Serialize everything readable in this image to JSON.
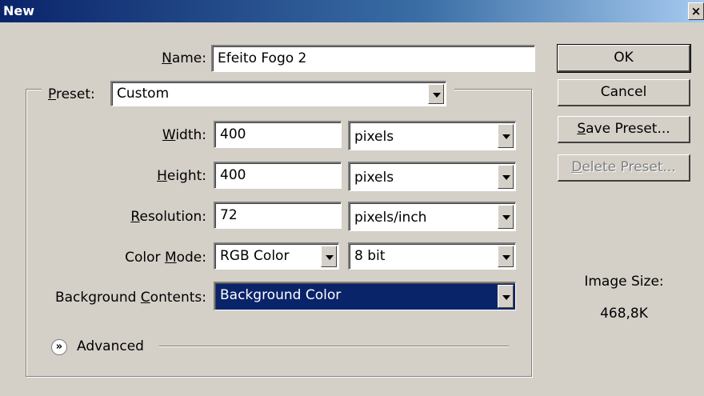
{
  "window": {
    "title": "New",
    "close_label": "×"
  },
  "form": {
    "name": {
      "label_underlined": "N",
      "label_rest": "ame:",
      "value": "Efeito Fogo 2"
    },
    "preset": {
      "label_underlined": "P",
      "label_rest": "reset:",
      "value": "Custom"
    },
    "width": {
      "label_underlined": "W",
      "label_rest": "idth:",
      "value": "400",
      "unit": "pixels"
    },
    "height": {
      "label_underlined": "H",
      "label_rest": "eight:",
      "value": "400",
      "unit": "pixels"
    },
    "resolution": {
      "label_underlined": "R",
      "label_rest": "esolution:",
      "value": "72",
      "unit": "pixels/inch"
    },
    "color_mode": {
      "label_pre": "Color ",
      "label_underlined": "M",
      "label_rest": "ode:",
      "value": "RGB Color",
      "depth": "8 bit"
    },
    "background": {
      "label_pre": "Background ",
      "label_underlined": "C",
      "label_rest": "ontents:",
      "value": "Background Color"
    },
    "advanced": {
      "label": "Advanced",
      "icon": "chevron-double-down-icon"
    }
  },
  "buttons": {
    "ok": "OK",
    "cancel": "Cancel",
    "save_underlined": "S",
    "save_rest": "ave Preset...",
    "delete_underlined": "D",
    "delete_rest": "elete Preset..."
  },
  "image_size": {
    "label": "Image Size:",
    "value": "468,8K"
  }
}
